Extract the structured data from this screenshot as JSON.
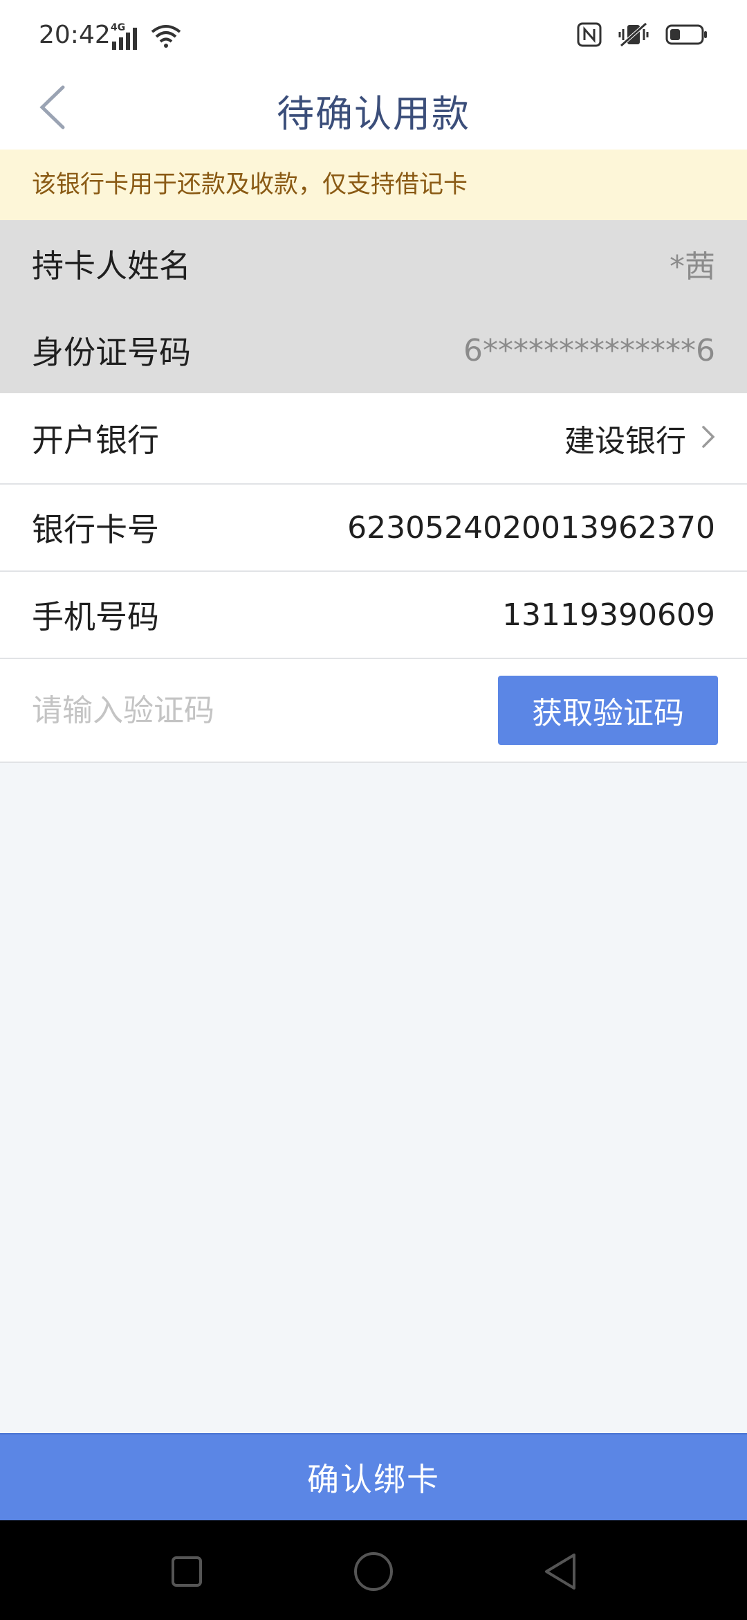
{
  "status_bar": {
    "time": "20:42",
    "network": "4G",
    "icons": [
      "signal-icon",
      "wifi-icon",
      "nfc-icon",
      "vibrate-icon",
      "battery-icon"
    ]
  },
  "header": {
    "title": "待确认用款",
    "back_icon": "back-chevron-icon"
  },
  "notice": {
    "text": "该银行卡用于还款及收款，仅支持借记卡"
  },
  "form": {
    "cardholder": {
      "label": "持卡人姓名",
      "value": "*茜"
    },
    "id_number": {
      "label": "身份证号码",
      "value": "6**************6"
    },
    "bank": {
      "label": "开户银行",
      "value": "建设银行"
    },
    "card_number": {
      "label": "银行卡号",
      "value": "6230524020013962370"
    },
    "phone": {
      "label": "手机号码",
      "value": "13119390609"
    },
    "verify_code": {
      "placeholder": "请输入验证码",
      "button_label": "获取验证码"
    }
  },
  "confirm_button": {
    "label": "确认绑卡"
  },
  "colors": {
    "accent": "#5b86e5",
    "title": "#3b4e7a",
    "notice_bg": "#fdf6d8",
    "notice_text": "#8a5a14",
    "disabled_row_bg": "#dddddd",
    "page_bg": "#f3f6f9"
  },
  "nav_bar": {
    "icons": [
      "recent-apps-icon",
      "home-icon",
      "back-icon"
    ]
  }
}
